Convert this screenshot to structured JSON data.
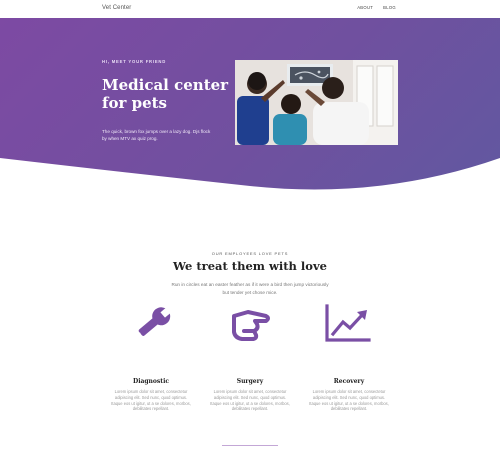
{
  "nav": {
    "brand": "Vet Center",
    "links": [
      "ABOUT",
      "BLOG"
    ]
  },
  "hero": {
    "eyebrow": "HI, MEET YOUR FRIEND",
    "title_line1": "Medical center",
    "title_line2": "for pets",
    "text": "The quick, brown fox jumps over a lazy dog. Djs flock by when MTV ax quiz prog."
  },
  "features_section": {
    "eyebrow": "OUR EMPLOYEES LOVE PETS",
    "title": "We treat them with love",
    "text": "Run in circles eat an easter feather as if it were a bird then jump victoriously but tender yet chose mice."
  },
  "features": [
    {
      "title": "Diagnostic",
      "text": "Lorem ipsum dolor sit amet, consectetur adipiscing elit. Sed nunc, quod optimus. Itaque eos ut igitur, ut a se dolores, morbos, debilitates repellant.",
      "icon": "wrench-icon"
    },
    {
      "title": "Surgery",
      "text": "Lorem ipsum dolor sit amet, consectetur adipiscing elit. Sed nunc, quod optimus. Itaque eos ut igitur, ut a se dolores, morbos, debilitates repellant.",
      "icon": "pointing-hand-icon"
    },
    {
      "title": "Recovery",
      "text": "Lorem ipsum dolor sit amet, consectetur adipiscing elit. Sed nunc, quod optimus. Itaque eos ut igitur, ut a se dolores, morbos, debilitates repellant.",
      "icon": "trend-up-icon"
    }
  ],
  "colors": {
    "accent": "#7a4fa5",
    "hero_gradient_start": "#7d4aa3",
    "hero_gradient_end": "#6158a0"
  }
}
